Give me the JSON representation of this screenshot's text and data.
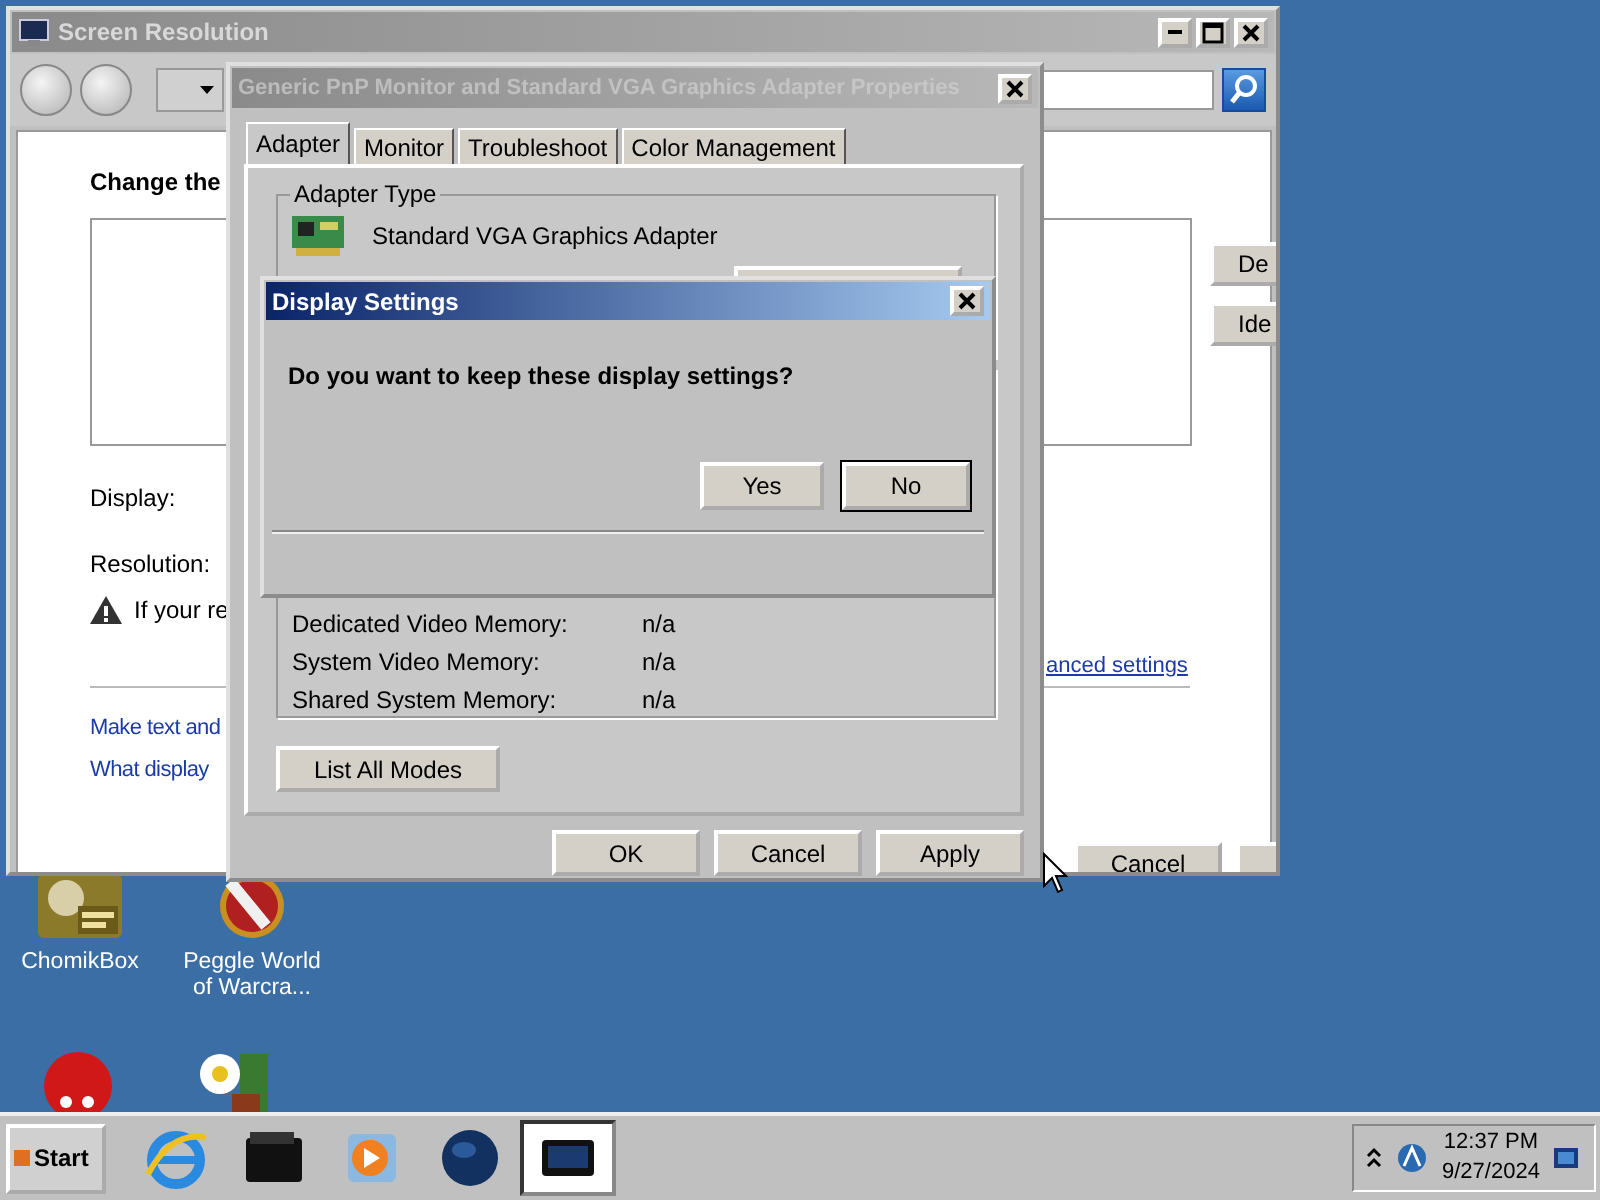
{
  "screen_resolution_window": {
    "title": "Screen Resolution",
    "active": false,
    "heading": "Change the",
    "display_label": "Display:",
    "resolution_label": "Resolution:",
    "warning": "If your re",
    "advanced_link": "anced settings",
    "links": [
      "Make text and",
      "What display"
    ],
    "side_buttons": [
      "De",
      "Ide"
    ],
    "cancel_button": "Cancel"
  },
  "properties_dialog": {
    "title": "Generic PnP Monitor and Standard VGA Graphics Adapter Properties",
    "active": false,
    "tabs": [
      {
        "label": "Adapter",
        "selected": true
      },
      {
        "label": "Monitor",
        "selected": false
      },
      {
        "label": "Troubleshoot",
        "selected": false
      },
      {
        "label": "Color Management",
        "selected": false
      }
    ],
    "adapter_type_legend": "Adapter Type",
    "adapter_name": "Standard VGA Graphics Adapter",
    "memory": [
      {
        "label": "Dedicated Video Memory:",
        "value": "n/a"
      },
      {
        "label": "System Video Memory:",
        "value": "n/a"
      },
      {
        "label": "Shared System Memory:",
        "value": "n/a"
      }
    ],
    "list_modes_button": "List All Modes",
    "buttons": [
      "OK",
      "Cancel",
      "Apply"
    ]
  },
  "message_box": {
    "title": "Display Settings",
    "active": true,
    "message": "Do you want to keep these display settings?",
    "buttons": [
      {
        "label": "Yes",
        "default": false
      },
      {
        "label": "No",
        "default": true
      }
    ]
  },
  "desktop_icons": [
    {
      "label": "ChomikBox",
      "kind": "box"
    },
    {
      "label": "Peggle World of Warcra...",
      "kind": "peggle"
    }
  ],
  "taskbar": {
    "start": "Start",
    "apps": [
      {
        "kind": "browser",
        "selected": false
      },
      {
        "kind": "folder",
        "selected": false
      },
      {
        "kind": "media",
        "selected": false
      },
      {
        "kind": "globe",
        "selected": false
      },
      {
        "kind": "display",
        "selected": true
      }
    ],
    "time": "12:37 PM",
    "date": "9/27/2024"
  }
}
